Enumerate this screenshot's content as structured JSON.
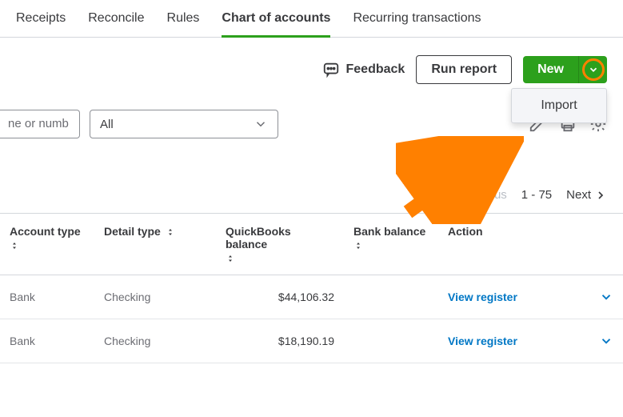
{
  "tabs": {
    "receipts": "Receipts",
    "reconcile": "Reconcile",
    "rules": "Rules",
    "chart": "Chart of accounts",
    "recurring": "Recurring transactions"
  },
  "toolbar": {
    "feedback": "Feedback",
    "run_report": "Run report",
    "new": "New",
    "dropdown_import": "Import"
  },
  "filters": {
    "search_placeholder": "ne or numb",
    "all": "All"
  },
  "pager": {
    "previous": "Previous",
    "range": "1 - 75",
    "next": "Next"
  },
  "columns": {
    "account_type": "Account type",
    "detail_type": "Detail type",
    "qb_balance": "QuickBooks balance",
    "bank_balance": "Bank balance",
    "action": "Action"
  },
  "rows": [
    {
      "account_type": "Bank",
      "detail_type": "Checking",
      "qb_balance": "$44,106.32",
      "bank_balance": "",
      "action": "View register"
    },
    {
      "account_type": "Bank",
      "detail_type": "Checking",
      "qb_balance": "$18,190.19",
      "bank_balance": "",
      "action": "View register"
    }
  ]
}
